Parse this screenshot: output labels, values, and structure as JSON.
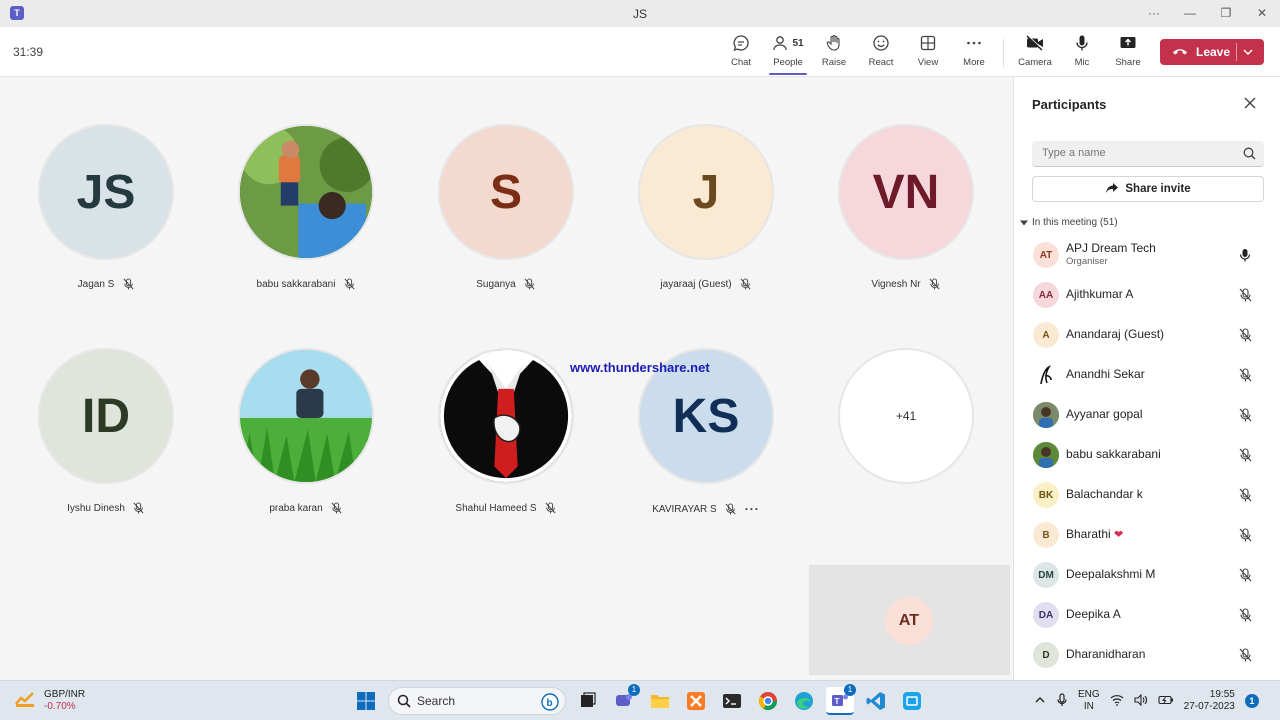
{
  "window": {
    "title": "JS",
    "controls": [
      "···",
      "—",
      "❐",
      "✕"
    ]
  },
  "toolbar": {
    "timer": "31:39",
    "buttons": {
      "chat": "Chat",
      "people": "People",
      "people_count": "51",
      "raise": "Raise",
      "react": "React",
      "view": "View",
      "more": "More",
      "camera": "Camera",
      "mic": "Mic",
      "share": "Share"
    },
    "leave": "Leave"
  },
  "stage": {
    "tiles": [
      {
        "initials": "JS",
        "name": "Jagan S",
        "bg": "#d9e3e7",
        "fg": "#243a3e",
        "photo": false
      },
      {
        "initials": "",
        "name": "babu sakkarabani",
        "bg": "#5d8a3a",
        "fg": "#fff",
        "photo": true
      },
      {
        "initials": "S",
        "name": "Suganya",
        "bg": "#f4d9cf",
        "fg": "#7a2e15",
        "photo": false
      },
      {
        "initials": "J",
        "name": "jayaraaj (Guest)",
        "bg": "#fbead3",
        "fg": "#6b4a22",
        "photo": false
      },
      {
        "initials": "VN",
        "name": "Vignesh Nr",
        "bg": "#f6d7dc",
        "fg": "#6d1b2b",
        "photo": false
      },
      {
        "initials": "ID",
        "name": "Iyshu Dinesh",
        "bg": "#dfe5da",
        "fg": "#2d3a25",
        "photo": false
      },
      {
        "initials": "",
        "name": "praba karan",
        "bg": "#9bd1e8",
        "fg": "#fff",
        "photo": true
      },
      {
        "initials": "",
        "name": "Shahul Hameed S",
        "bg": "#111",
        "fg": "#fff",
        "photo": true
      },
      {
        "initials": "KS",
        "name": "KAVIRAYAR S",
        "bg": "#cbdcec",
        "fg": "#112e56",
        "photo": false
      },
      {
        "initials": "+41",
        "name": "",
        "bg": "#ffffff",
        "fg": "#333",
        "photo": false
      }
    ],
    "more_options": "···",
    "watermark": "www.thundershare.net",
    "self_view_initials": "AT"
  },
  "panel": {
    "title": "Participants",
    "search_placeholder": "Type a name",
    "share_invite": "Share invite",
    "section": "In this meeting (51)",
    "participants": [
      {
        "initials": "AT",
        "name": "APJ Dream Tech",
        "role": "Organiser",
        "bg": "#fbe0d8",
        "fg": "#8a3a22",
        "mic": "on"
      },
      {
        "initials": "AA",
        "name": "Ajithkumar A",
        "role": "",
        "bg": "#f6d7dc",
        "fg": "#8a2a3b",
        "mic": "off"
      },
      {
        "initials": "A",
        "name": "Anandaraj (Guest)",
        "role": "",
        "bg": "#fbead3",
        "fg": "#7a5420",
        "mic": "off"
      },
      {
        "initials": "",
        "name": "Anandhi Sekar",
        "role": "",
        "bg": "#ffffff",
        "fg": "#111",
        "mic": "off",
        "photo": "sketch"
      },
      {
        "initials": "",
        "name": "Ayyanar gopal",
        "role": "",
        "bg": "#7a8a6a",
        "fg": "#fff",
        "mic": "off",
        "photo": "photo"
      },
      {
        "initials": "",
        "name": "babu sakkarabani",
        "role": "",
        "bg": "#5d8a3a",
        "fg": "#fff",
        "mic": "off",
        "photo": "photo"
      },
      {
        "initials": "BK",
        "name": "Balachandar k",
        "role": "",
        "bg": "#fbefc5",
        "fg": "#6b5412",
        "mic": "off"
      },
      {
        "initials": "B",
        "name": "Bharathi",
        "role": "",
        "bg": "#fbead3",
        "fg": "#7a5420",
        "mic": "off",
        "heart": "❤"
      },
      {
        "initials": "DM",
        "name": "Deepalakshmi M",
        "role": "",
        "bg": "#dce6e6",
        "fg": "#2a4646",
        "mic": "off"
      },
      {
        "initials": "DA",
        "name": "Deepika A",
        "role": "",
        "bg": "#e1def0",
        "fg": "#3b3366",
        "mic": "off"
      },
      {
        "initials": "D",
        "name": "Dharanidharan",
        "role": "",
        "bg": "#dfe5da",
        "fg": "#2d3a25",
        "mic": "off"
      }
    ]
  },
  "taskbar": {
    "weather_label": "GBP/INR",
    "weather_value": "-0.70%",
    "search": "Search",
    "chat_badge": "1",
    "teams_badge": "1",
    "lang_top": "ENG",
    "lang_bottom": "IN",
    "time": "19:55",
    "date": "27-07-2023",
    "notif": "1"
  },
  "colors": {
    "accent": "#5b5fc7",
    "leave": "#c4314b"
  }
}
